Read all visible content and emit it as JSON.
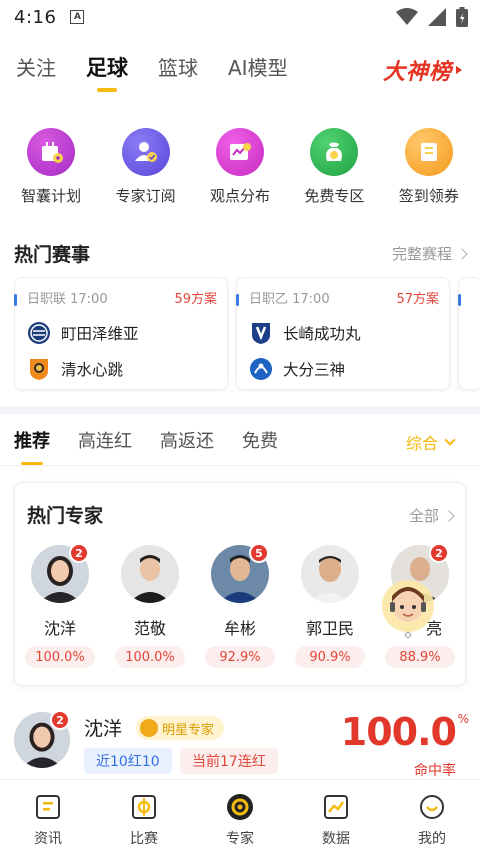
{
  "status": {
    "time": "4:16"
  },
  "top_tabs": [
    "关注",
    "足球",
    "篮球",
    "AI模型"
  ],
  "dashen": "大神榜",
  "quick": [
    "智囊计划",
    "专家订阅",
    "观点分布",
    "免费专区",
    "签到领券"
  ],
  "hot_events": {
    "title": "热门赛事",
    "more": "完整赛程",
    "matches": [
      {
        "league_time": "日职联 17:00",
        "plans": "59方案",
        "home": "町田泽维亚",
        "away": "清水心跳"
      },
      {
        "league_time": "日职乙 17:00",
        "plans": "57方案",
        "home": "长崎成功丸",
        "away": "大分三神"
      }
    ]
  },
  "sub_tabs": [
    "推荐",
    "高连红",
    "高返还",
    "免费"
  ],
  "sort": "综合",
  "experts": {
    "title": "热门专家",
    "all": "全部",
    "list": [
      {
        "name": "沈洋",
        "rate": "100.0%",
        "badge": "2"
      },
      {
        "name": "范敬",
        "rate": "100.0%",
        "badge": ""
      },
      {
        "name": "牟彬",
        "rate": "92.9%",
        "badge": "5"
      },
      {
        "name": "郭卫民",
        "rate": "90.9%",
        "badge": ""
      },
      {
        "name": "亮",
        "rate": "88.9%",
        "badge": "2"
      }
    ]
  },
  "expert_item": {
    "name": "沈洋",
    "badge": "2",
    "star_label": "明星专家",
    "tag_recent": "近10红10",
    "tag_streak": "当前17连红",
    "rate": "100.0",
    "rate_pct": "%",
    "rate_label": "命中率"
  },
  "bottom_nav": [
    "资讯",
    "比赛",
    "专家",
    "数据",
    "我的"
  ]
}
